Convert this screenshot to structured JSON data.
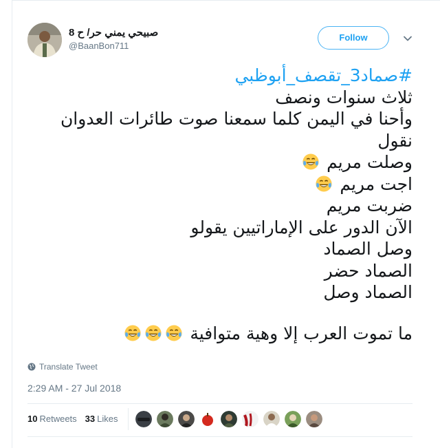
{
  "header": {
    "display_name": "صبيحي يمني حر/ ح 8",
    "handle": "@BaanBon711",
    "follow_label": "Follow",
    "avatar_icon": "user-avatar-photo",
    "caret_icon": "chevron-down-icon"
  },
  "tweet": {
    "hashtag": "#صماد3_تقصف_أبوظبي",
    "lines": [
      "ثلاث سنوات ونصف",
      "وأحنا في اليمن كلما سمعنا صوت طائرات العدوان",
      "نقول",
      "وصلت مريم",
      "اجت مريم",
      "ضربت مريم",
      "الآن الدور على الإماراتيين يقولو",
      "وصل الصماد",
      "الصماد حضر",
      "الصماد وصل"
    ],
    "final_line": "ما تموت العرب إلا وهية متوافية",
    "emoji_name": "face-with-tears-of-joy"
  },
  "translate_label": "Translate Tweet",
  "timestamp": "2:29 AM - 27 Jul 2018",
  "stats": {
    "retweets_count": "10",
    "retweets_label": "Retweets",
    "likes_count": "33",
    "likes_label": "Likes"
  },
  "likers_count": 9,
  "colors": {
    "link_blue": "#1da1f2",
    "secondary_text": "#657786",
    "border": "#e6ecf0"
  }
}
